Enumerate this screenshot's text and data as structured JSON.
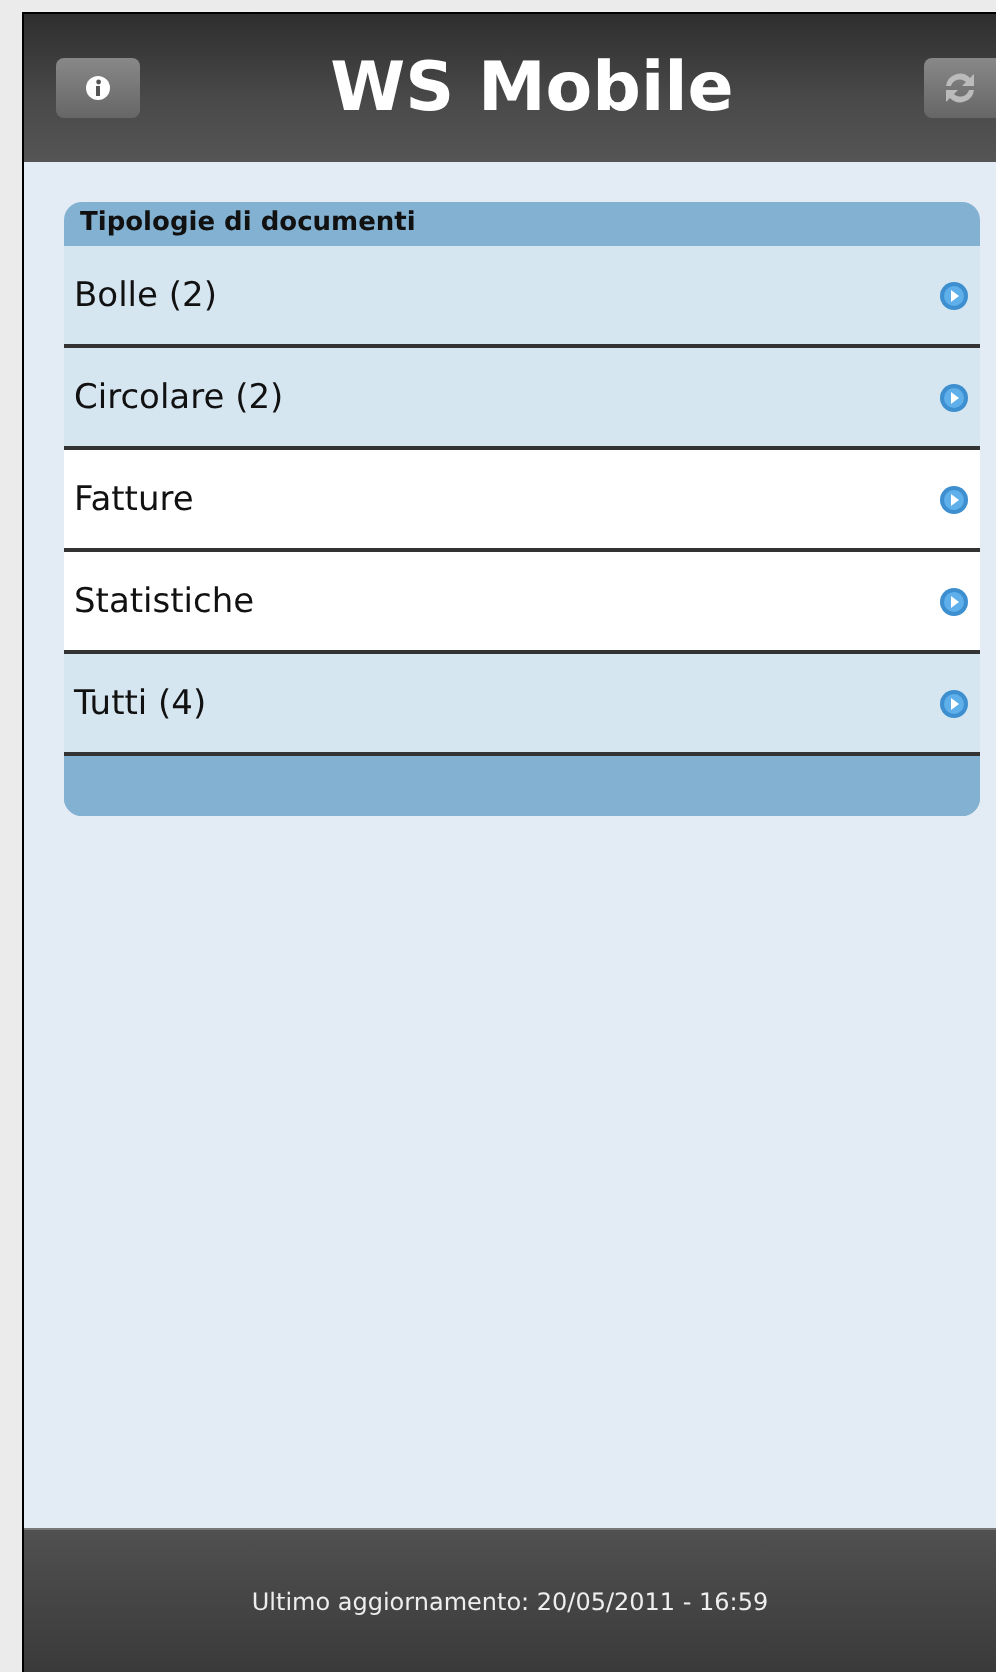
{
  "header": {
    "title": "WS Mobile"
  },
  "list": {
    "title": "Tipologie di documenti",
    "items": [
      {
        "label": "Bolle (2)",
        "highlighted": true
      },
      {
        "label": "Circolare (2)",
        "highlighted": true
      },
      {
        "label": "Fatture",
        "highlighted": false
      },
      {
        "label": "Statistiche",
        "highlighted": false
      },
      {
        "label": "Tutti (4)",
        "highlighted": true
      }
    ]
  },
  "status_bar": {
    "text": "Ultimo aggiornamento: 20/05/2011 - 16:59"
  }
}
